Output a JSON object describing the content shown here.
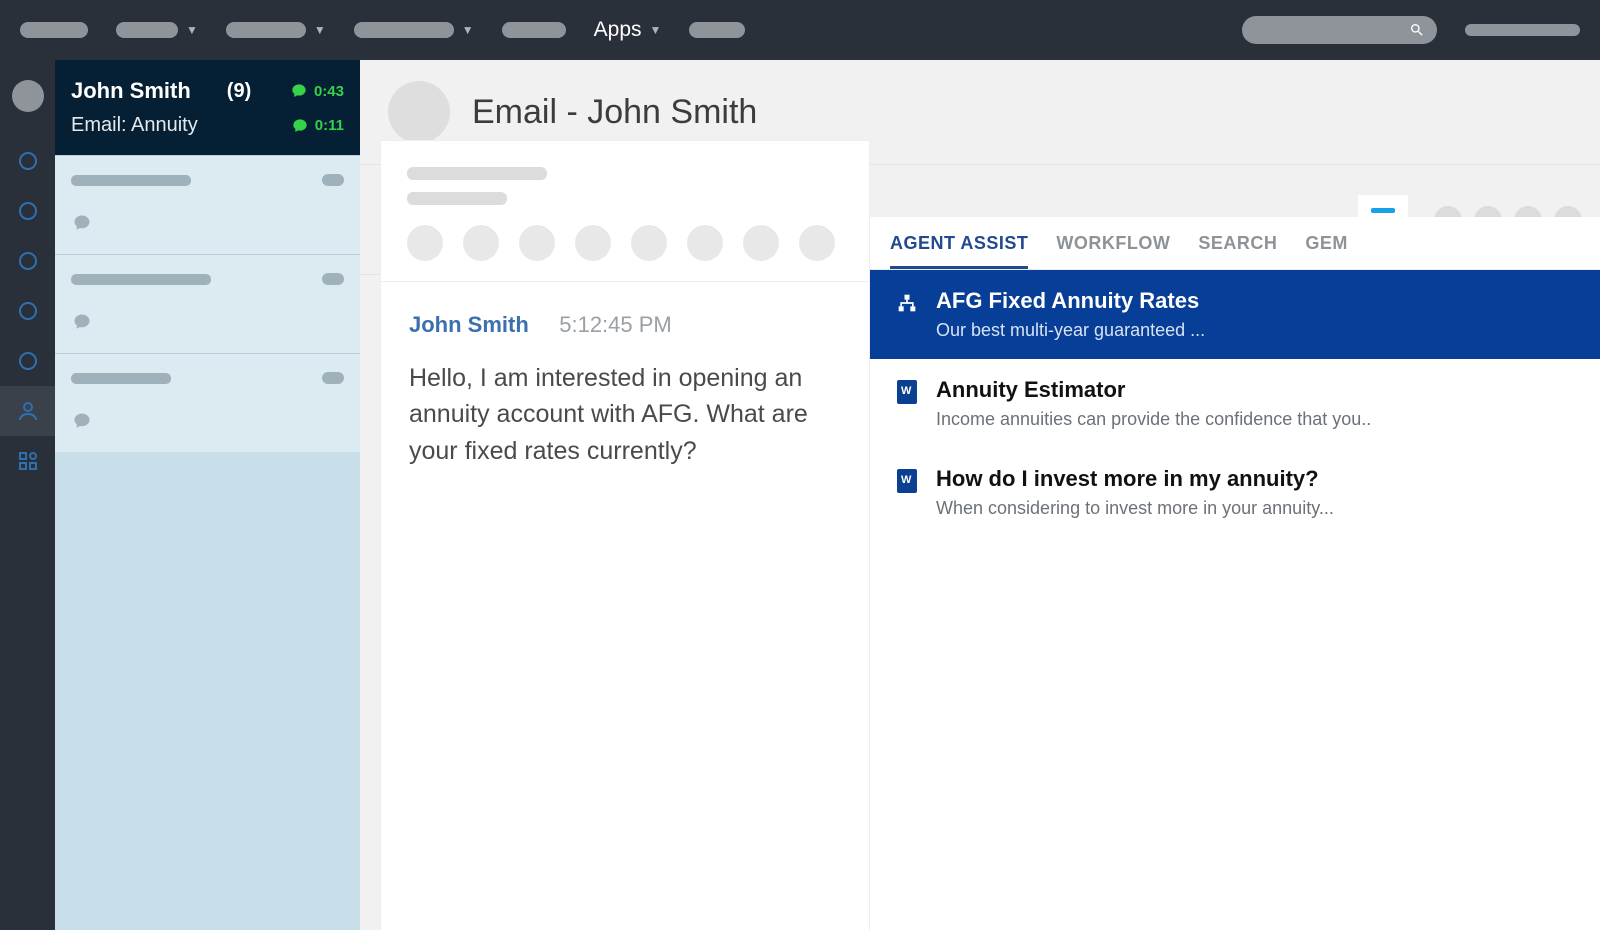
{
  "topnav": {
    "apps_label": "Apps"
  },
  "sidebar": {
    "active_card": {
      "name": "John Smith",
      "badge": "(9)",
      "subject_line": "Email: Annuity",
      "timer_a": "0:43",
      "timer_b": "0:11"
    }
  },
  "header": {
    "title": "Email - John Smith"
  },
  "email": {
    "sender": "John Smith",
    "time": "5:12:45 PM",
    "body": "Hello, I am interested in opening an annuity account with AFG. What are your fixed rates currently?"
  },
  "assist": {
    "tabs": {
      "agent_assist": "AGENT ASSIST",
      "workflow": "WORKFLOW",
      "search": "SEARCH",
      "gem": "GEM"
    },
    "items": [
      {
        "title": "AFG Fixed Annuity Rates",
        "sub": "Our best multi-year guaranteed ...",
        "icon": "flow",
        "selected": true
      },
      {
        "title": "Annuity Estimator",
        "sub": "Income annuities can provide the confidence that you..",
        "icon": "word",
        "selected": false
      },
      {
        "title": "How do I invest more in my annuity?",
        "sub": "When considering to invest more in your annuity...",
        "icon": "word",
        "selected": false
      }
    ]
  }
}
